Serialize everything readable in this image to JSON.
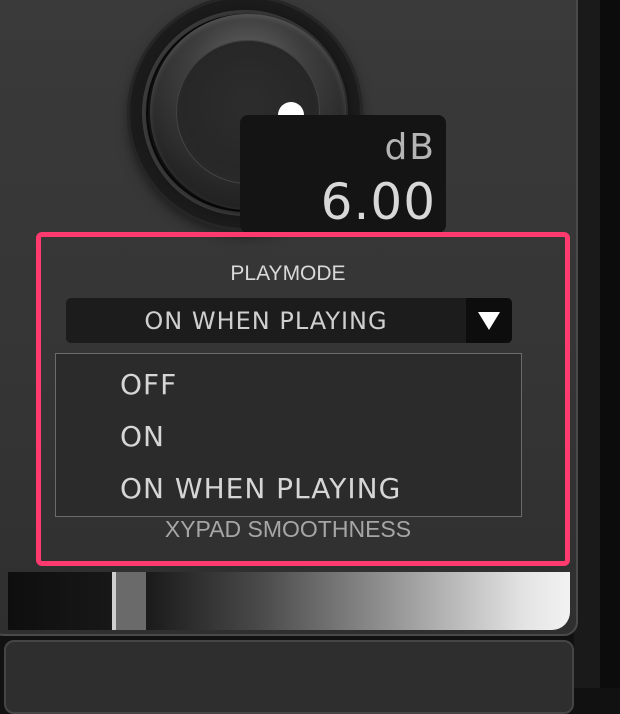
{
  "knob": {
    "unit": "dB",
    "value": "6.00"
  },
  "playmode": {
    "label": "PLAYMODE",
    "selected": "ON WHEN PLAYING",
    "options": [
      "OFF",
      "ON",
      "ON WHEN PLAYING"
    ]
  },
  "xypad": {
    "label": "XYPAD SMOOTHNESS"
  },
  "colors": {
    "highlight": "#ff3a6e",
    "panel": "#383838",
    "dropdown_bg": "#2b2b2b"
  }
}
